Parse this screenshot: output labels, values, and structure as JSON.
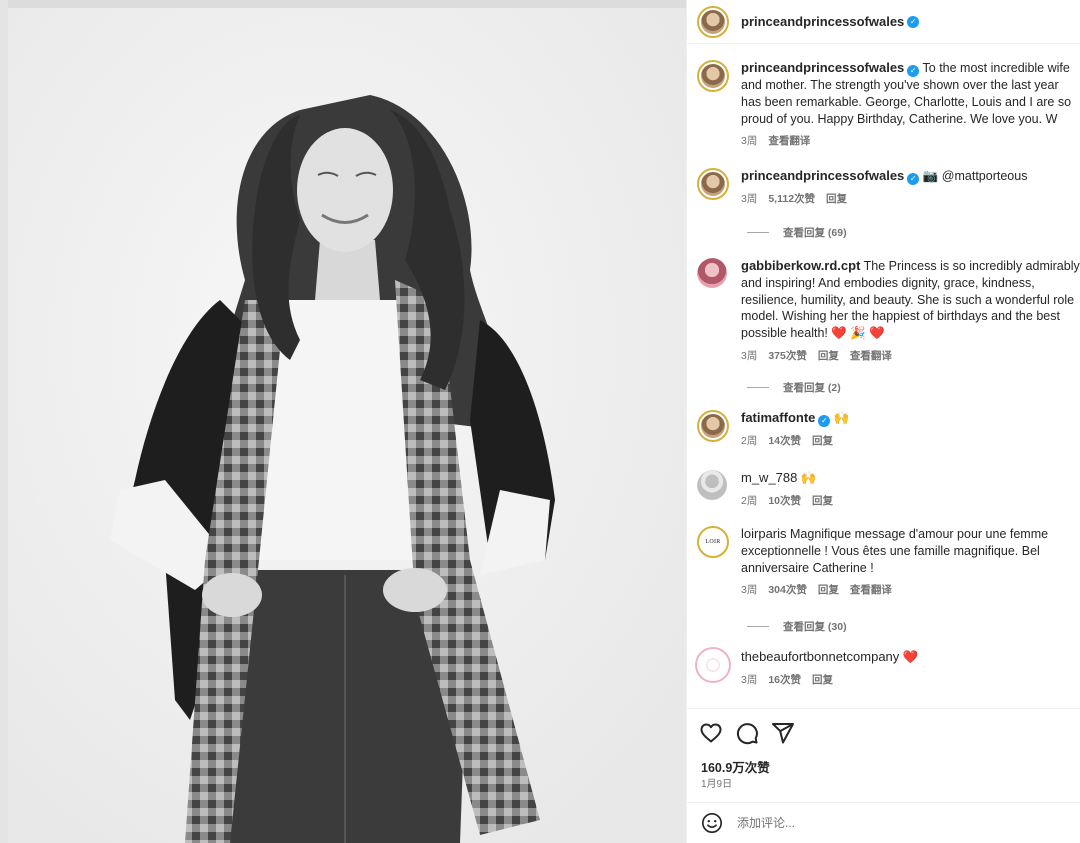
{
  "post": {
    "author": "princeandprincessofwales",
    "likes": "160.9万次赞",
    "date": "1月9日"
  },
  "comments": [
    {
      "username": "princeandprincessofwales",
      "text": "To the most incredible wife and mother. The strength you've shown over the last year has been remarkable. George, Charlotte, Louis and I are so proud of you. Happy Birthday, Catherine. We love you. W",
      "time": "3周",
      "translate": "查看翻译"
    },
    {
      "username": "princeandprincessofwales",
      "text": "📷 @mattporteous",
      "time": "3周",
      "likes": "5,112次赞",
      "reply": "回复",
      "view_replies": "查看回复 (69)"
    },
    {
      "username": "gabbiberkow.rd.cpt",
      "text": "The Princess is so incredibly admirably and inspiring! And embodies dignity, grace, kindness, resilience, humility, and beauty. She is such a wonderful role model. Wishing her the happiest of birthdays and the best possible health! ❤️ 🎉 ❤️",
      "time": "3周",
      "likes": "375次赞",
      "reply": "回复",
      "translate": "查看翻译",
      "view_replies": "查看回复 (2)"
    },
    {
      "username": "fatimaffonte",
      "text": "🙌",
      "time": "2周",
      "likes": "14次赞",
      "reply": "回复"
    },
    {
      "username": "m_w_788",
      "text": "🙌",
      "time": "2周",
      "likes": "10次赞",
      "reply": "回复"
    },
    {
      "username": "loirparis",
      "avatar_text": "LOIR",
      "text": "Magnifique message d'amour pour une femme exceptionnelle ! Vous êtes une famille magnifique. Bel anniversaire Catherine !",
      "time": "3周",
      "likes": "304次赞",
      "reply": "回复",
      "translate": "查看翻译",
      "view_replies": "查看回复 (30)"
    },
    {
      "username": "thebeaufortbonnetcompany",
      "text": "❤️",
      "time": "3周",
      "likes": "16次赞",
      "reply": "回复"
    }
  ],
  "composer": {
    "placeholder": "添加评论..."
  },
  "icons": {
    "like": "heart-outline-icon",
    "comment": "speech-bubble-icon",
    "share": "paper-plane-icon",
    "emoji": "smiley-icon",
    "verified": "verified-badge-icon"
  },
  "colors": {
    "verified": "#1d9bf0",
    "heart": "#e0245e",
    "muted_text": "#737373"
  }
}
